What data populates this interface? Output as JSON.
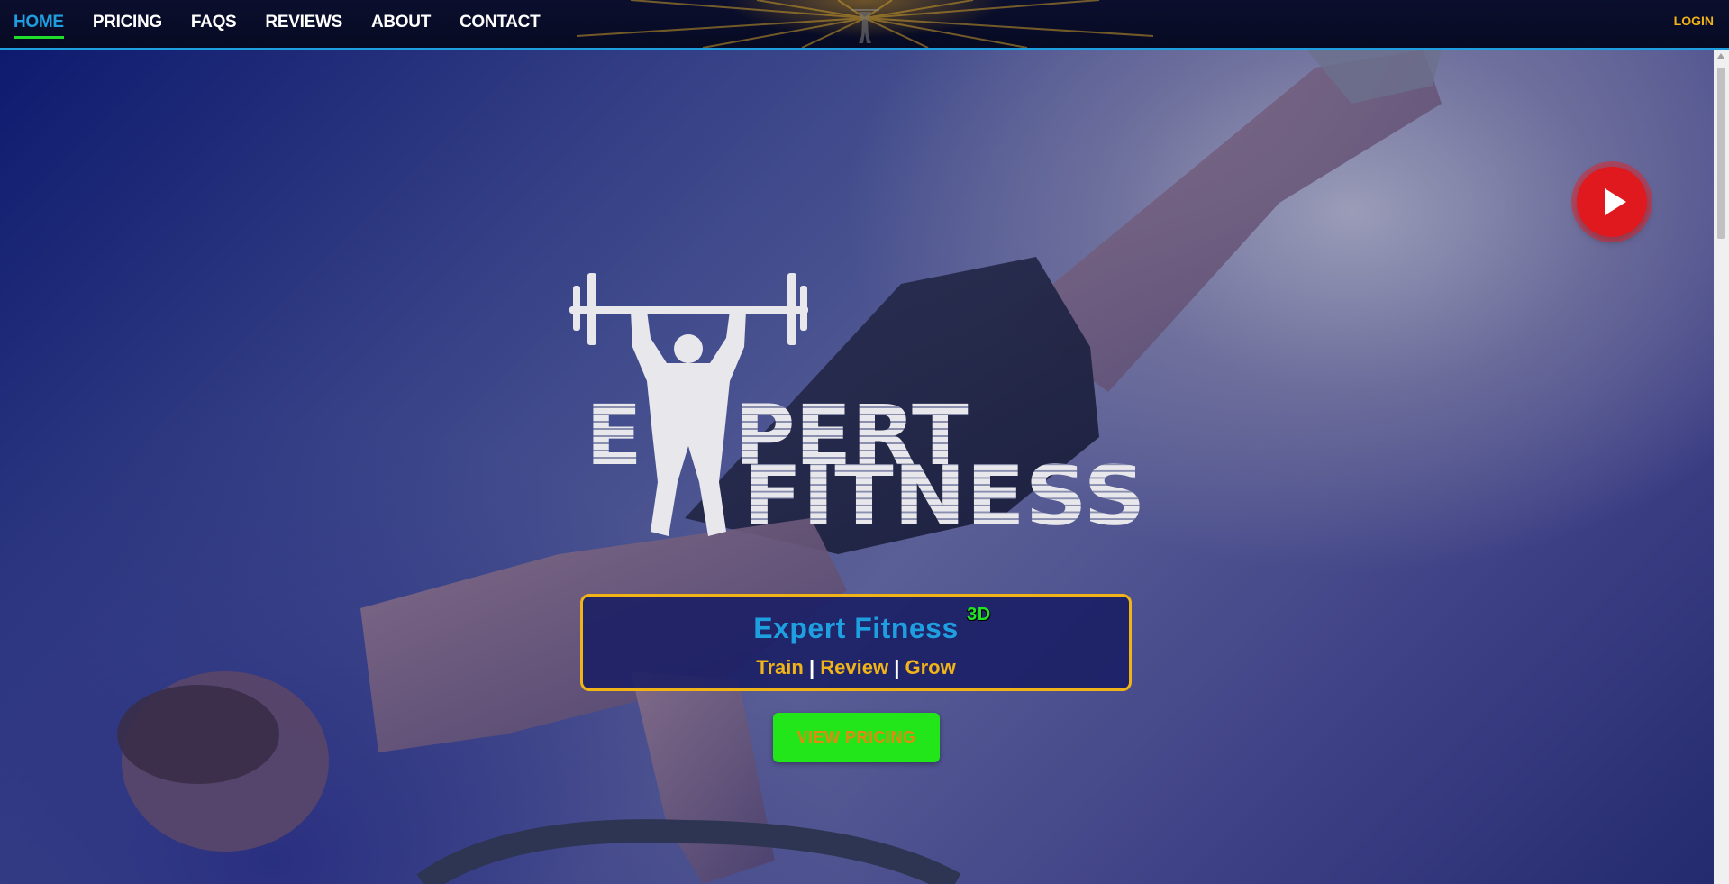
{
  "nav": {
    "links": [
      {
        "label": "HOME",
        "active": true
      },
      {
        "label": "PRICING",
        "active": false
      },
      {
        "label": "FAQS",
        "active": false
      },
      {
        "label": "REVIEWS",
        "active": false
      },
      {
        "label": "ABOUT",
        "active": false
      },
      {
        "label": "CONTACT",
        "active": false
      }
    ],
    "login_label": "LOGIN"
  },
  "hero": {
    "logo_text": [
      "EXPERT",
      "FITNESS"
    ],
    "brand_title": "Expert Fitness",
    "brand_sup": "3D",
    "tagline": {
      "words": [
        "Train",
        "Review",
        "Grow"
      ],
      "separator": "|"
    },
    "cta_label": "VIEW PRICING",
    "play_icon": "play-icon",
    "scroll_icon": "chevron-down-icon"
  },
  "colors": {
    "accent_blue": "#1e9fe0",
    "accent_gold": "#f0b318",
    "accent_green": "#22e61a",
    "play_red": "#e0191e",
    "nav_bg": "#070a22"
  }
}
